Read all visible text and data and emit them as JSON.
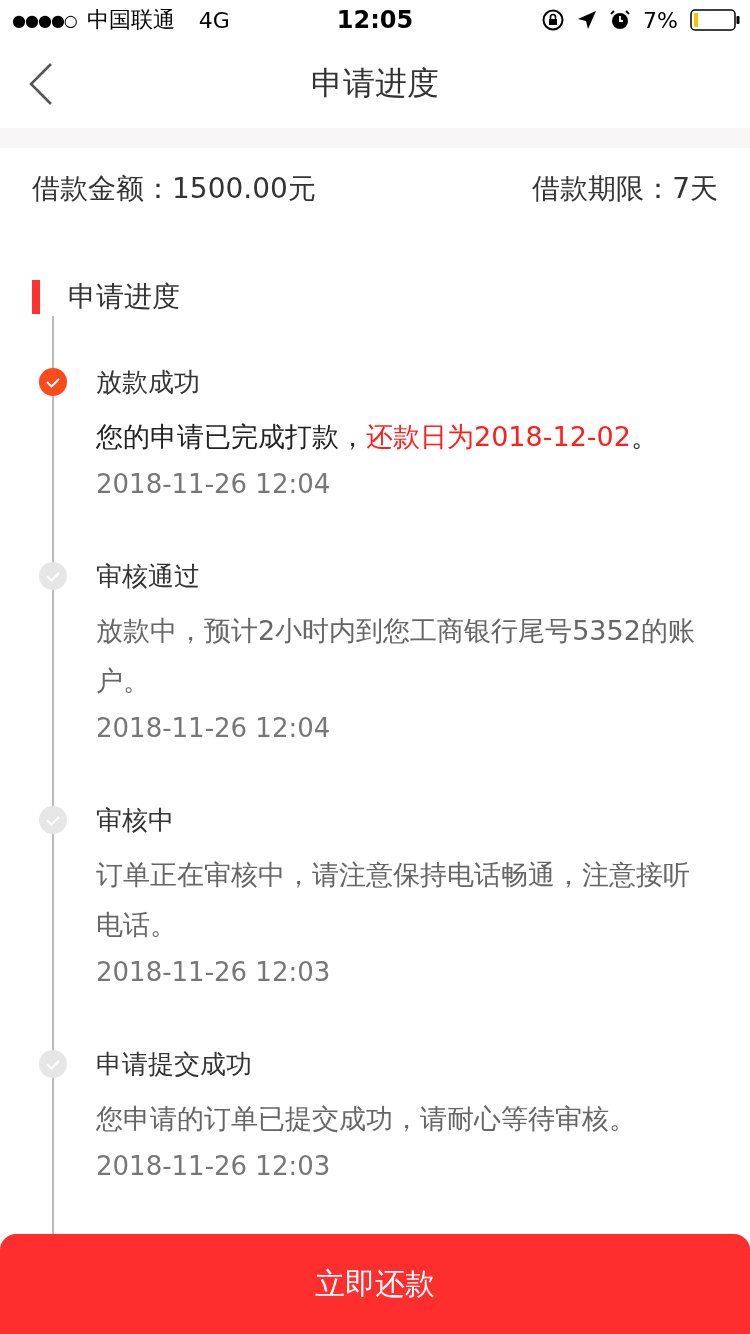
{
  "status_bar": {
    "signal": "●●●●○",
    "carrier": "中国联通",
    "network": "4G",
    "time": "12:05",
    "battery_text": "7%"
  },
  "nav": {
    "title": "申请进度"
  },
  "loan": {
    "amount": "借款金额：1500.00元",
    "term": "借款期限：7天"
  },
  "section": {
    "title": "申请进度"
  },
  "steps": [
    {
      "title": "放款成功",
      "done": true,
      "parts": [
        {
          "text": "您的申请已完成打款，",
          "highlight": false
        },
        {
          "text": "还款日为2018-12-02",
          "highlight": true
        },
        {
          "text": "。",
          "highlight": false
        }
      ],
      "time": "2018-11-26 12:04"
    },
    {
      "title": "审核通过",
      "done": false,
      "parts": [
        {
          "text": "放款中，预计2小时内到您工商银行尾号5352的账户。",
          "highlight": false
        }
      ],
      "time": "2018-11-26 12:04"
    },
    {
      "title": "审核中",
      "done": false,
      "parts": [
        {
          "text": "订单正在审核中，请注意保持电话畅通，注意接听电话。",
          "highlight": false
        }
      ],
      "time": "2018-11-26 12:03"
    },
    {
      "title": "申请提交成功",
      "done": false,
      "parts": [
        {
          "text": "您申请的订单已提交成功，请耐心等待审核。",
          "highlight": false
        }
      ],
      "time": "2018-11-26 12:03"
    }
  ],
  "button": {
    "label": "立即还款"
  }
}
